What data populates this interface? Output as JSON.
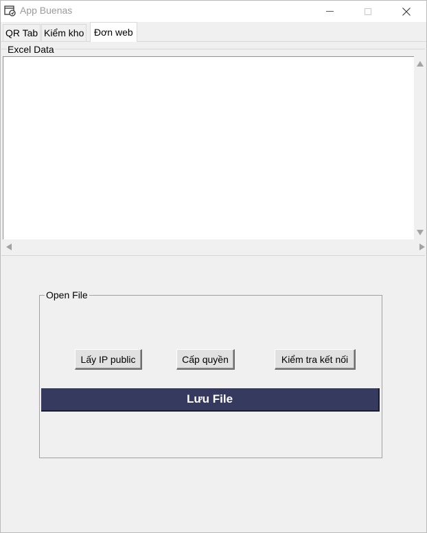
{
  "window": {
    "title": "App Buenas"
  },
  "tabs": [
    {
      "label": "QR Tab"
    },
    {
      "label": "Kiểm kho"
    },
    {
      "label": "Đơn web"
    }
  ],
  "excel": {
    "label": "Excel Data",
    "content": ""
  },
  "open_file": {
    "label": "Open File",
    "buttons": {
      "public_ip": "Lấy IP public",
      "grant": "Cấp quyền",
      "check": "Kiểm tra kết nối"
    },
    "save": "Lưu File"
  },
  "colors": {
    "save_button_bg": "#363a5e",
    "save_button_text": "#ffffff"
  }
}
